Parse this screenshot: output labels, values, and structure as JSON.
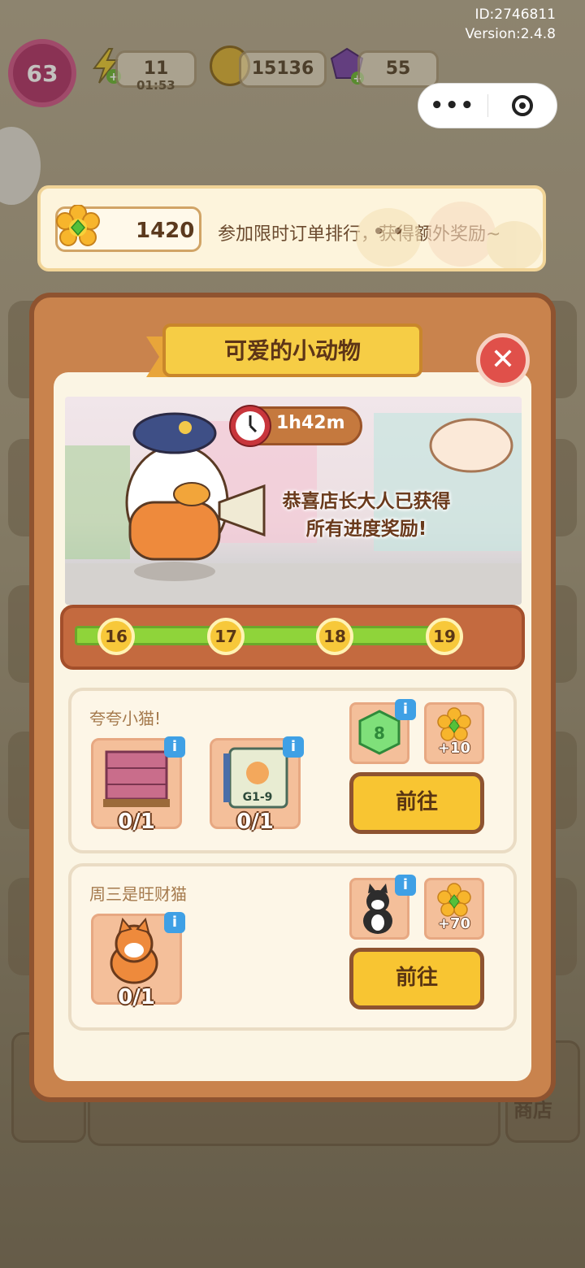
{
  "header": {
    "id_text": "ID:2746811",
    "version_text": "Version:2.4.8"
  },
  "hud": {
    "level": "63",
    "energy": "11",
    "energy_timer": "01:53",
    "coins": "15136",
    "gems": "55"
  },
  "banner": {
    "score": "1420",
    "text": "参加限时订单排行，获得额外奖励~"
  },
  "event": {
    "title": "可爱的小动物",
    "timer": "1h42m",
    "message_line1": "恭喜店长大人已获得",
    "message_line2": "所有进度奖励!",
    "progress_nodes": [
      "16",
      "17",
      "18",
      "19"
    ],
    "progress": 1.0
  },
  "tasks": [
    {
      "title": "夸夸小猫!",
      "items": [
        {
          "name": "brick-pallet",
          "count": "0/1"
        },
        {
          "name": "sketchbook-g1-9",
          "count": "0/1"
        }
      ],
      "rewards": [
        {
          "name": "gem-8",
          "label": ""
        },
        {
          "name": "flower-points",
          "label": "+10"
        }
      ],
      "button": "前往"
    },
    {
      "title": "周三是旺财猫",
      "items": [
        {
          "name": "shiba-dog",
          "count": "0/1"
        }
      ],
      "rewards": [
        {
          "name": "tuxedo-cat",
          "label": ""
        },
        {
          "name": "flower-points",
          "label": "+70"
        }
      ],
      "button": "前往"
    }
  ],
  "background": {
    "shop_label": "商店"
  },
  "colors": {
    "panel": "#c9834d",
    "panel_border": "#8e5330",
    "button": "#f8c532",
    "progress": "#8fd43a",
    "close": "#e0504a"
  }
}
